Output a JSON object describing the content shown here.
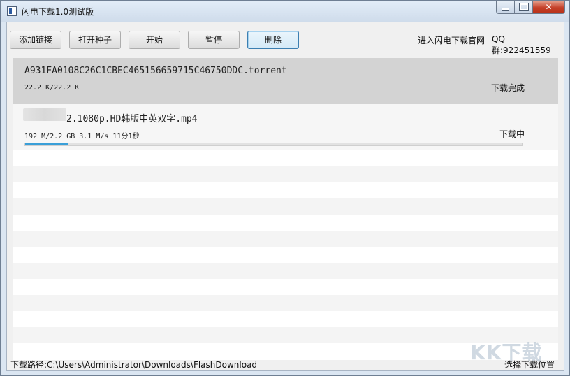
{
  "window": {
    "title": "闪电下载1.0测试版"
  },
  "toolbar": {
    "add_link": "添加链接",
    "open_torrent": "打开种子",
    "start": "开始",
    "pause": "暂停",
    "delete": "删除",
    "site_link": "进入闪电下载官网",
    "qq_group": "QQ群:922451559"
  },
  "downloads": [
    {
      "name": "A931FA0108C26C1CBEC465156659715C46750DDC.torrent",
      "info": "22.2 K/22.2 K",
      "status": "下载完成"
    },
    {
      "name": "2.1080p.HD韩版中英双字.mp4",
      "info": "192 M/2.2 GB  3.1 M/s  11分1秒",
      "status": "下载中",
      "progress": 0.085
    }
  ],
  "footer": {
    "path": "下载路径:C:\\Users\\Administrator\\Downloads\\FlashDownload",
    "choose_location": "选择下载位置"
  },
  "watermark": "KK下载",
  "colors": {
    "progress": "#3a9fd8",
    "selected_row": "#d3d3d3",
    "close_button": "#c5412a"
  }
}
